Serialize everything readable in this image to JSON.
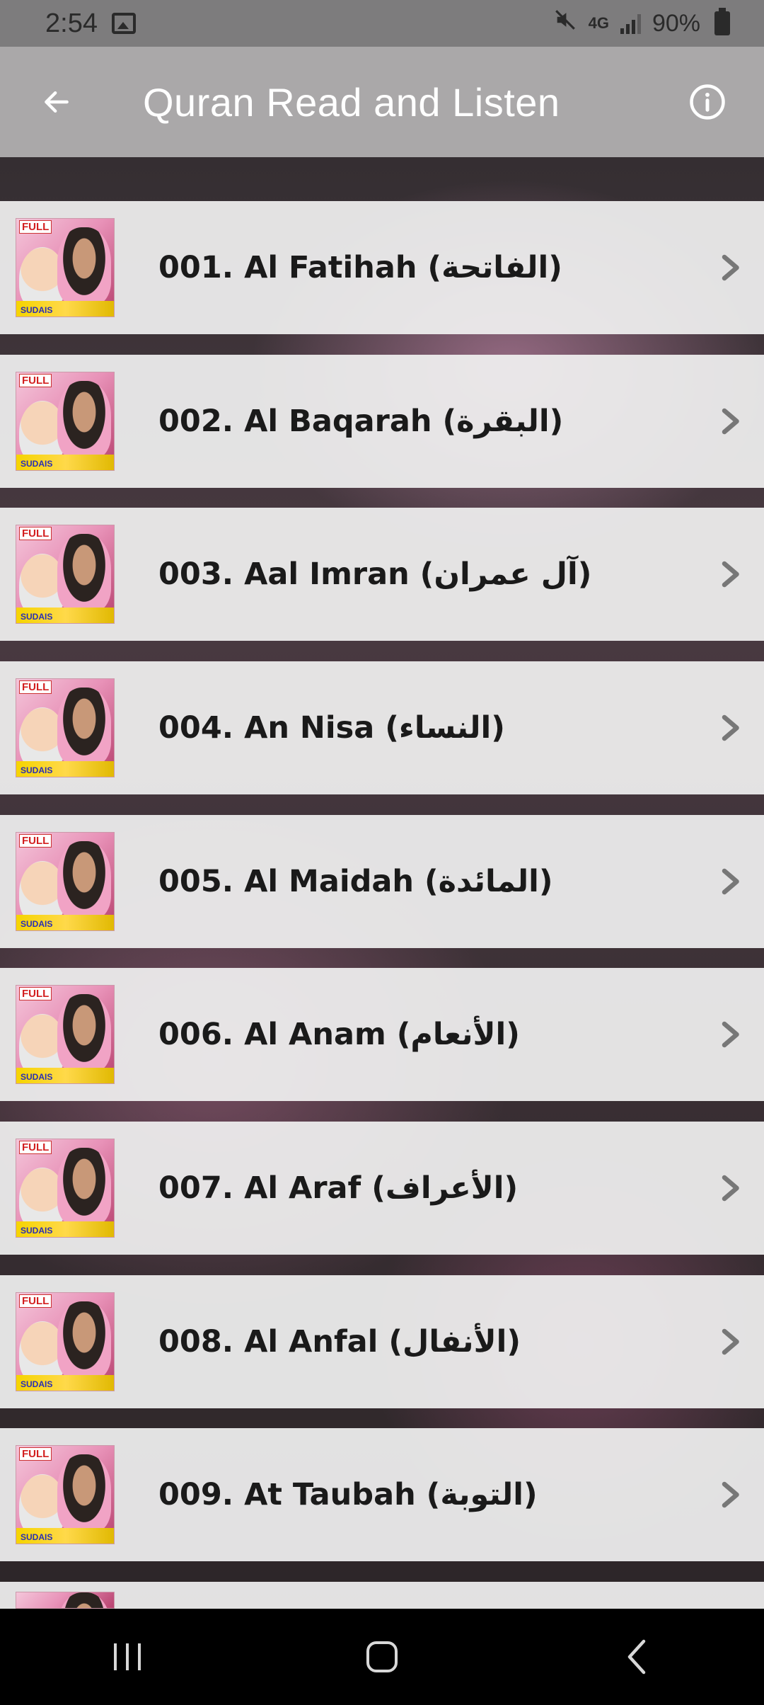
{
  "status_bar": {
    "time": "2:54",
    "network": "4G",
    "battery": "90%",
    "icons": [
      "image-icon",
      "mute-icon",
      "data-icon",
      "signal-icon",
      "battery-icon"
    ]
  },
  "app_bar": {
    "title": "Quran Read and Listen",
    "back_icon": "arrow-left-icon",
    "info_icon": "info-icon"
  },
  "thumbnail": {
    "tag": "FULL",
    "caption": "SUDAIS"
  },
  "surahs": [
    {
      "label": "001. Al Fatihah (الفاتحة)"
    },
    {
      "label": "002. Al Baqarah (البقرة)"
    },
    {
      "label": "003. Aal Imran (آل عمران)"
    },
    {
      "label": "004. An Nisa (النساء)"
    },
    {
      "label": "005. Al Maidah (المائدة)"
    },
    {
      "label": "006. Al Anam (الأنعام)"
    },
    {
      "label": "007. Al Araf (الأعراف)"
    },
    {
      "label": "008. Al Anfal (الأنفال)"
    },
    {
      "label": "009. At Taubah (التوبة)"
    },
    {
      "label": ""
    }
  ],
  "nav_bar": {
    "icons": [
      "recent-apps-icon",
      "home-icon",
      "back-icon"
    ]
  },
  "colors": {
    "status_bar": "#7d7c7d",
    "app_bar": "#aaa8a9",
    "list_item": "#f0f0f0",
    "text": "#1a1a1a",
    "nav_bar": "#000000"
  }
}
